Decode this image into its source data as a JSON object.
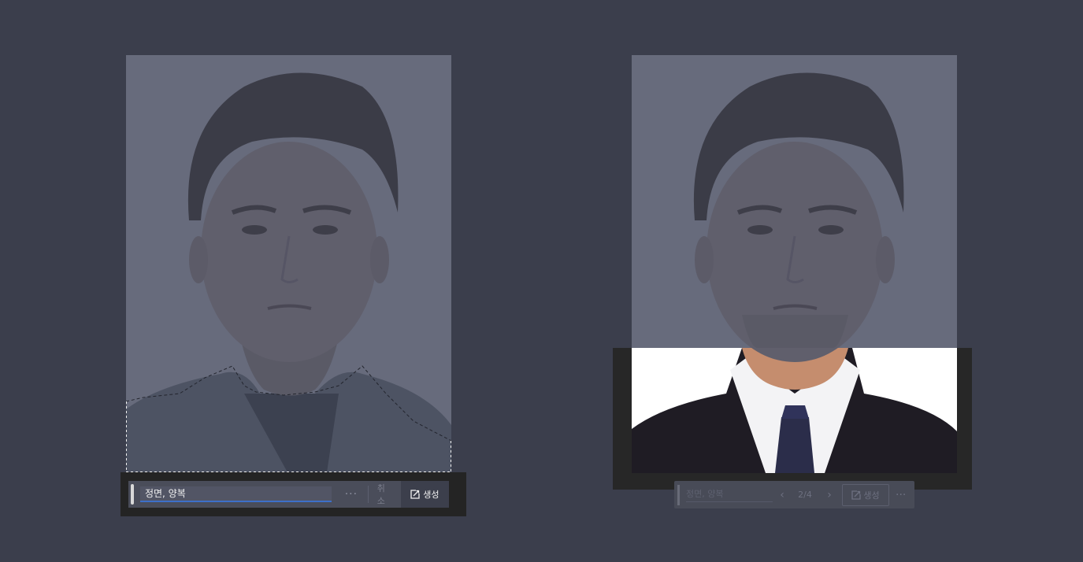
{
  "left_panel": {
    "prompt_value": "정면, 양복",
    "more_label": "···",
    "cancel_label": "취소",
    "generate_label": "생성"
  },
  "right_panel": {
    "prompt_value": "정면, 양복",
    "page_indicator": "2/4",
    "generate_label": "생성",
    "more_label": "···",
    "prev_icon": "chevron-left-icon",
    "next_icon": "chevron-right-icon"
  },
  "colors": {
    "canvas_bg": "#3b3e4c",
    "selection_accent": "#3d6fc9",
    "overlay_dim": "#676b7c"
  }
}
